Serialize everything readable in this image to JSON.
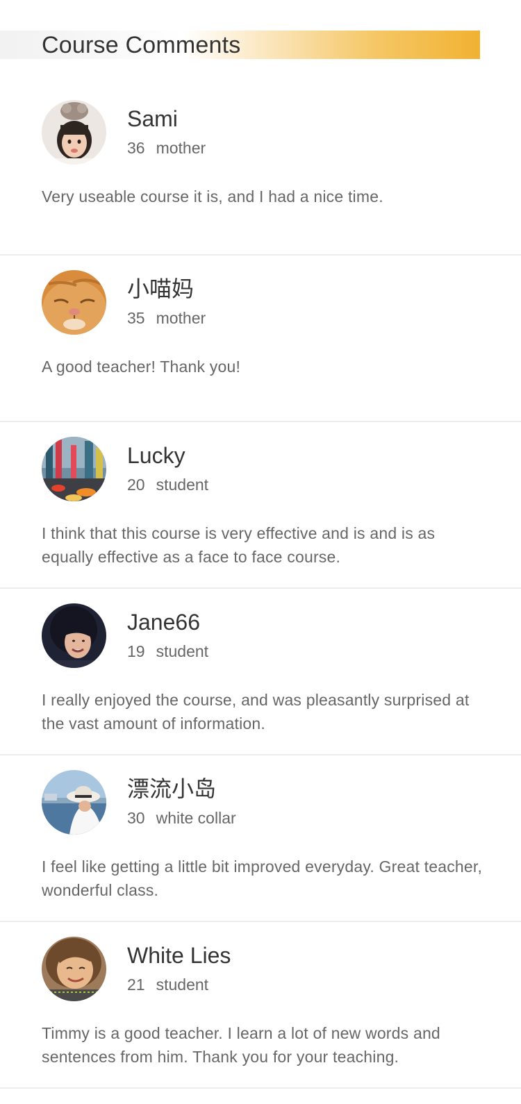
{
  "header": {
    "title": "Course Comments"
  },
  "colors": {
    "accent": "#f1b232",
    "divider": "#ececec",
    "text_primary": "#333333",
    "text_secondary": "#666666"
  },
  "comments": [
    {
      "name": "Sami",
      "age": "36",
      "role": "mother",
      "text": "Very useable course it is, and I had a nice time.",
      "avatar_icon": "child-photo-avatar"
    },
    {
      "name": "小喵妈",
      "age": "35",
      "role": "mother",
      "text": "A good teacher! Thank you!",
      "avatar_icon": "cat-photo-avatar"
    },
    {
      "name": "Lucky",
      "age": "20",
      "role": "student",
      "text": "I think that this course is very effective and is and is as equally effective as a face to face course.",
      "avatar_icon": "city-street-photo-avatar"
    },
    {
      "name": "Jane66",
      "age": "19",
      "role": "student",
      "text": "I really enjoyed the course, and was pleasantly surprised at the vast amount of information.",
      "avatar_icon": "woman-portrait-avatar"
    },
    {
      "name": "漂流小岛",
      "age": "30",
      "role": "white collar",
      "text": "I feel like getting a little bit improved everyday. Great teacher, wonderful class.",
      "avatar_icon": "seaside-hat-photo-avatar"
    },
    {
      "name": "White Lies",
      "age": "21",
      "role": "student",
      "text": "Timmy is a good teacher. I learn a lot of new words and sentences from him. Thank you for your teaching.",
      "avatar_icon": "girl-selfie-avatar"
    }
  ]
}
